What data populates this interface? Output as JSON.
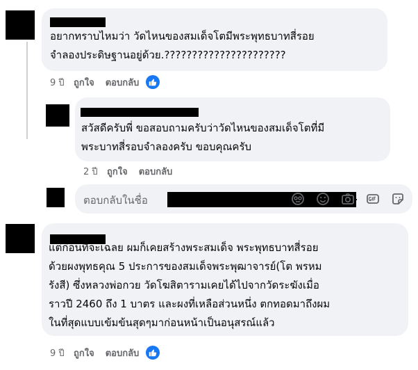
{
  "comments": [
    {
      "text_lines": [
        "อยากทราบไหมว่า วัดไหนของสมเด็จโตมีพระพุทธบาทสี่รอย",
        "จำลองประดิษฐานอยู่ด้วย.??????????????????????"
      ],
      "time": "9 ปี",
      "like_label": "ถูกใจ",
      "reply_label": "ตอบกลับ",
      "reaction_icon": "like-icon"
    },
    {
      "text_lines": [
        "สวัสดีครับพี่ ขอสอบถามครับว่าวัดไหนของสมเด็จโตที่มี",
        "พระบาทสี่รอบจำลองครับ ขอบคุณครับ"
      ],
      "time": "2 ปี",
      "like_label": "ถูกใจ",
      "reply_label": "ตอบกลับ"
    },
    {
      "text_lines": [
        "แต่ก่อนที่จะเฉลย ผมก็เคยสร้างพระสมเด็จ พระพุทธบาทสี่รอย",
        "ด้วยผงพุทธคุณ 5 ประการของสมเด็จพระพุฒาจารย์(โต พรหม",
        "รังสี) ซึ่งหลวงพ่อกวย วัดโฆสิตารามเคยได้ไปจากวัดระฆังเมื่อ",
        "ราวปี 2460 ถึง 1 บาตร และผงที่เหลือส่วนหนึ่ง ตกทอดมาถึงผม",
        "ในที่สุดแบบเข้มข้นสุดๆมาก่อนหน้าเป็นอนุสรณ์แล้ว"
      ],
      "time": "9 ปี",
      "like_label": "ถูกใจ",
      "reply_label": "ตอบกลับ",
      "reaction_icon": "like-icon"
    }
  ],
  "reply_box": {
    "prefix": "ตอบกลับในชื่อ",
    "icons": [
      "avatar-sticker-icon",
      "emoji-icon",
      "camera-icon",
      "gif-icon",
      "sticker-icon"
    ]
  },
  "colors": {
    "bubble_bg": "#f0f2f5",
    "meta_text": "#65676b",
    "like_blue": "#1877f2",
    "redaction": "#000000"
  }
}
